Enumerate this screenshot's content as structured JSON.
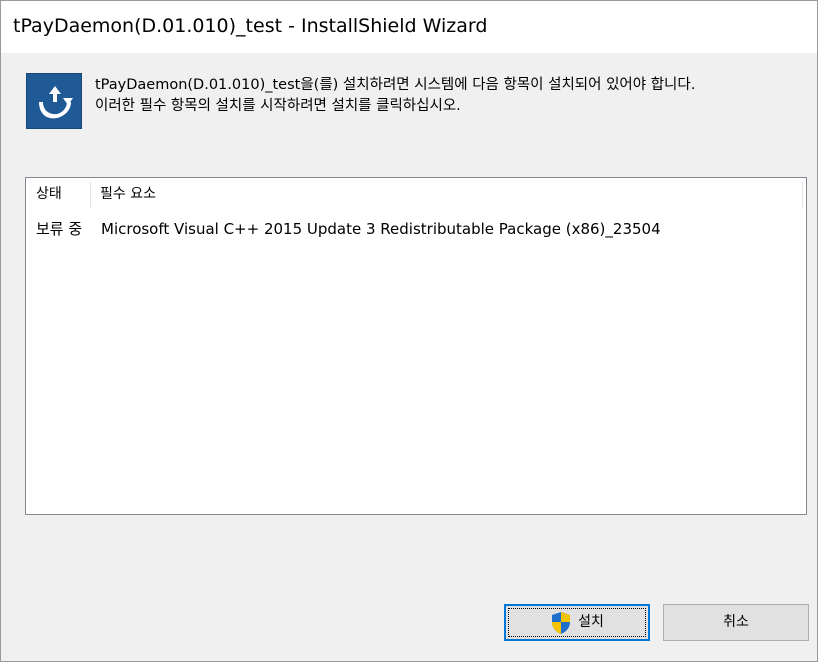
{
  "window": {
    "title": "tPayDaemon(D.01.010)_test - InstallShield Wizard"
  },
  "header": {
    "icon": "installshield-arrow-icon",
    "line1": "tPayDaemon(D.01.010)_test을(를) 설치하려면 시스템에 다음 항목이 설치되어 있어야 합니다.",
    "line2": "이러한 필수 항목의 설치를 시작하려면 설치를 클릭하십시오."
  },
  "list": {
    "columns": [
      "상태",
      "필수 요소"
    ],
    "rows": [
      {
        "status": "보류 중",
        "requirement": "Microsoft Visual C++ 2015 Update 3 Redistributable Package (x86)_23504"
      }
    ]
  },
  "buttons": {
    "install_label": "설치",
    "install_icon": "uac-shield-icon",
    "cancel_label": "취소"
  },
  "colors": {
    "accent": "#0078d7",
    "icon_bg": "#1f5a97",
    "shield_blue": "#1d6fce",
    "shield_yellow": "#f5c400"
  }
}
